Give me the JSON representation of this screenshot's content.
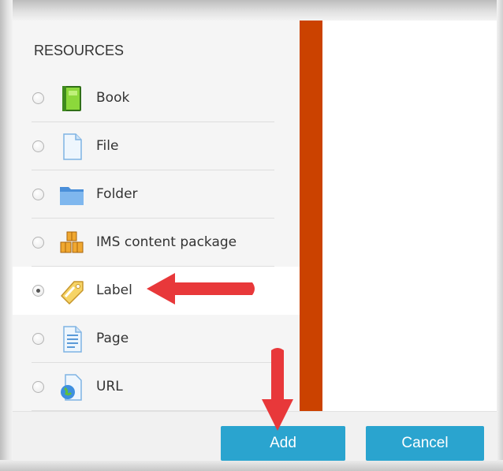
{
  "dialog": {
    "section_title": "RESOURCES",
    "selected_item": "Label",
    "items": [
      {
        "label": "Book",
        "icon": "book-icon",
        "selected": false
      },
      {
        "label": "File",
        "icon": "file-icon",
        "selected": false
      },
      {
        "label": "Folder",
        "icon": "folder-icon",
        "selected": false
      },
      {
        "label": "IMS content package",
        "icon": "ims-package-icon",
        "selected": false
      },
      {
        "label": "Label",
        "icon": "label-tag-icon",
        "selected": true
      },
      {
        "label": "Page",
        "icon": "page-icon",
        "selected": false
      },
      {
        "label": "URL",
        "icon": "url-icon",
        "selected": false
      }
    ]
  },
  "footer": {
    "add_label": "Add",
    "cancel_label": "Cancel"
  },
  "colors": {
    "accent_bar": "#cb4200",
    "button": "#2aa4cf",
    "annotation_arrow": "#e8383a"
  }
}
